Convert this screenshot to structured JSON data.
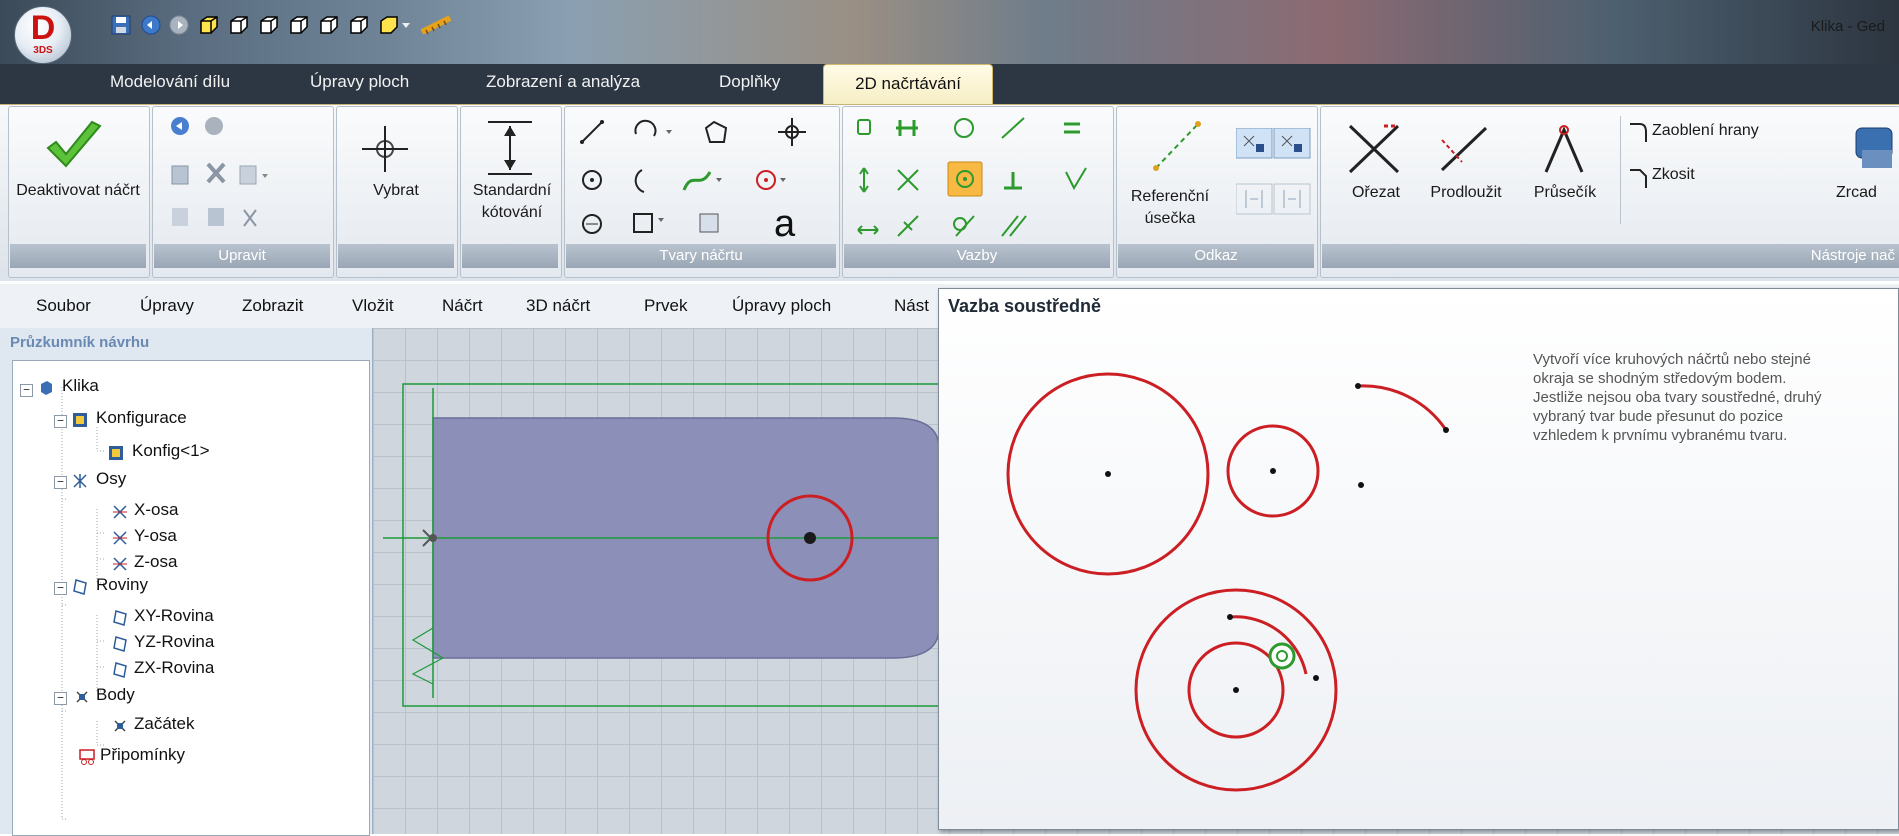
{
  "window": {
    "title": "Klika - Ged"
  },
  "app": {
    "logo_letter": "D",
    "logo_sub": "3DS"
  },
  "tabs": [
    "Modelování dílu",
    "Úpravy ploch",
    "Zobrazení a analýza",
    "Doplňky",
    "2D načrtávání"
  ],
  "active_tab": "2D načrtávání",
  "ribbon": {
    "deactivate": "Deaktivovat náčrt",
    "select": "Vybrat",
    "dimension": "Standardní kótování",
    "text_tool": "a",
    "reference": "Referenční úsečka",
    "trim": "Ořezat",
    "extend": "Prodloužit",
    "intersect": "Průsečík",
    "fillet": "Zaoblení hrany",
    "chamfer": "Zkosit",
    "mirror": "Zrcad",
    "groups": {
      "edit": "Upravit",
      "shapes": "Tvary náčrtu",
      "constraints": "Vazby",
      "reference": "Odkaz",
      "tools": "Nástroje nač"
    }
  },
  "menu": [
    "Soubor",
    "Úpravy",
    "Zobrazit",
    "Vložit",
    "Náčrt",
    "3D náčrt",
    "Prvek",
    "Úpravy ploch",
    "Nást"
  ],
  "explorer": {
    "title": "Průzkumník návrhu",
    "tree": [
      "Klika",
      "Konfigurace",
      "Konfig<1>",
      "Osy",
      "X-osa",
      "Y-osa",
      "Z-osa",
      "Roviny",
      "XY-Rovina",
      "YZ-Rovina",
      "ZX-Rovina",
      "Body",
      "Začátek",
      "Připomínky"
    ]
  },
  "tooltip": {
    "title": "Vazba soustředně",
    "description": "Vytvoří více kruhových náčrtů nebo stejné okraja se shodným středovým bodem. Jestliže nejsou oba tvary soustředné, druhý vybraný tvar bude přesunut do pozice vzhledem k prvnímu vybranému tvaru."
  },
  "colors": {
    "accent": "#f2d37a",
    "sketch_red": "#cc1f24",
    "axis_green": "#1d9a3a",
    "part_fill": "#8c90b8"
  }
}
